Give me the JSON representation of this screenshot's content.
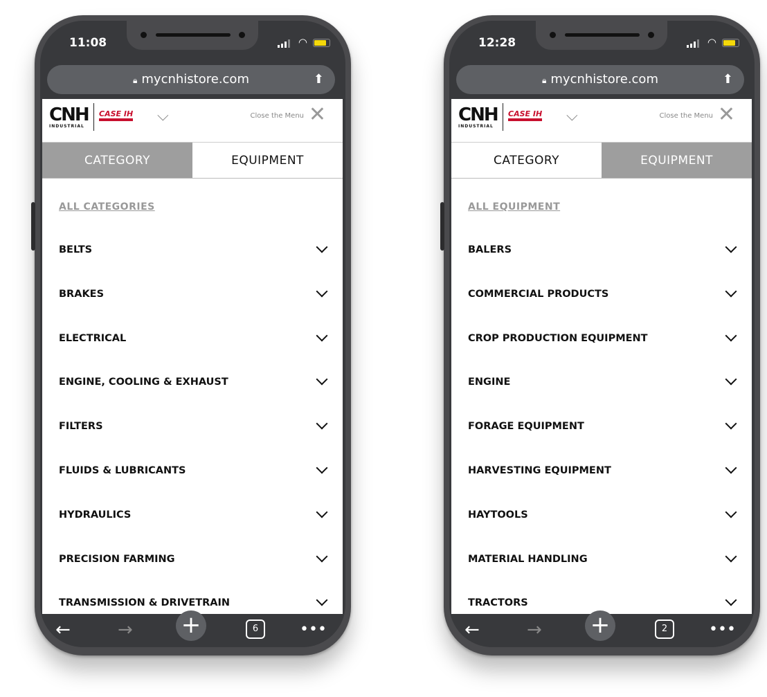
{
  "phones": [
    {
      "time": "11:08",
      "url": "mycnhistore.com",
      "brand": {
        "logo": "CNH INDUSTRIAL",
        "sub": "CASE IH"
      },
      "close_label": "Close the Menu",
      "tabs": [
        "CATEGORY",
        "EQUIPMENT"
      ],
      "active_tab": 1,
      "all_link": "ALL CATEGORIES",
      "items": [
        "BELTS",
        "BRAKES",
        "ELECTRICAL",
        "ENGINE, COOLING & EXHAUST",
        "FILTERS",
        "FLUIDS & LUBRICANTS",
        "HYDRAULICS",
        "PRECISION FARMING",
        "TRANSMISSION & DRIVETRAIN"
      ],
      "tab_count": "6"
    },
    {
      "time": "12:28",
      "url": "mycnhistore.com",
      "brand": {
        "logo": "CNH INDUSTRIAL",
        "sub": "CASE IH"
      },
      "close_label": "Close the Menu",
      "tabs": [
        "CATEGORY",
        "EQUIPMENT"
      ],
      "active_tab": 0,
      "all_link": "ALL EQUIPMENT",
      "items": [
        "BALERS",
        "COMMERCIAL PRODUCTS",
        "CROP PRODUCTION EQUIPMENT",
        "ENGINE",
        "FORAGE EQUIPMENT",
        "HARVESTING EQUIPMENT",
        "HAYTOOLS",
        "MATERIAL HANDLING",
        "TRACTORS"
      ],
      "tab_count": "2"
    }
  ],
  "colors": {
    "battery": "#f5d90a",
    "brand_red": "#c8102e",
    "inactive_tab": "#9e9e9e"
  }
}
